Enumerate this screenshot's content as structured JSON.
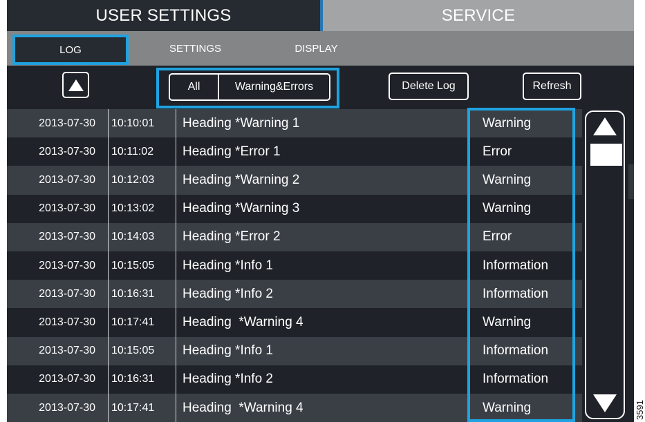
{
  "top_tabs": {
    "user_settings": "USER SETTINGS",
    "service": "SERVICE"
  },
  "sub_tabs": {
    "log": "LOG",
    "settings": "SETTINGS",
    "display": "DISPLAY"
  },
  "toolbar": {
    "filter_all": "All",
    "filter_warnings_errors": "Warning&Errors",
    "delete_log": "Delete Log",
    "refresh": "Refresh"
  },
  "log_entries": [
    {
      "date": "2013-07-30",
      "time": "10:10:01",
      "heading": "Heading *Warning 1",
      "type": "Warning"
    },
    {
      "date": "2013-07-30",
      "time": "10:11:02",
      "heading": "Heading *Error 1",
      "type": "Error"
    },
    {
      "date": "2013-07-30",
      "time": "10:12:03",
      "heading": "Heading *Warning 2",
      "type": "Warning"
    },
    {
      "date": "2013-07-30",
      "time": "10:13:02",
      "heading": "Heading *Warning 3",
      "type": "Warning"
    },
    {
      "date": "2013-07-30",
      "time": "10:14:03",
      "heading": "Heading *Error 2",
      "type": "Error"
    },
    {
      "date": "2013-07-30",
      "time": "10:15:05",
      "heading": "Heading *Info 1",
      "type": "Information"
    },
    {
      "date": "2013-07-30",
      "time": "10:16:31",
      "heading": "Heading *Info 2",
      "type": "Information"
    },
    {
      "date": "2013-07-30",
      "time": "10:17:41",
      "heading": "Heading  *Warning 4",
      "type": "Warning"
    },
    {
      "date": "2013-07-30",
      "time": "10:15:05",
      "heading": "Heading *Info 1",
      "type": "Information"
    },
    {
      "date": "2013-07-30",
      "time": "10:16:31",
      "heading": "Heading *Info 2",
      "type": "Information"
    },
    {
      "date": "2013-07-30",
      "time": "10:17:41",
      "heading": "Heading  *Warning 4",
      "type": "Warning"
    }
  ],
  "figure_number": "3591",
  "colors": {
    "highlight": "#1fa3e0",
    "background": "#1f2329",
    "row_alt": "#3a3f46",
    "service_tab": "#a2a4a6"
  }
}
